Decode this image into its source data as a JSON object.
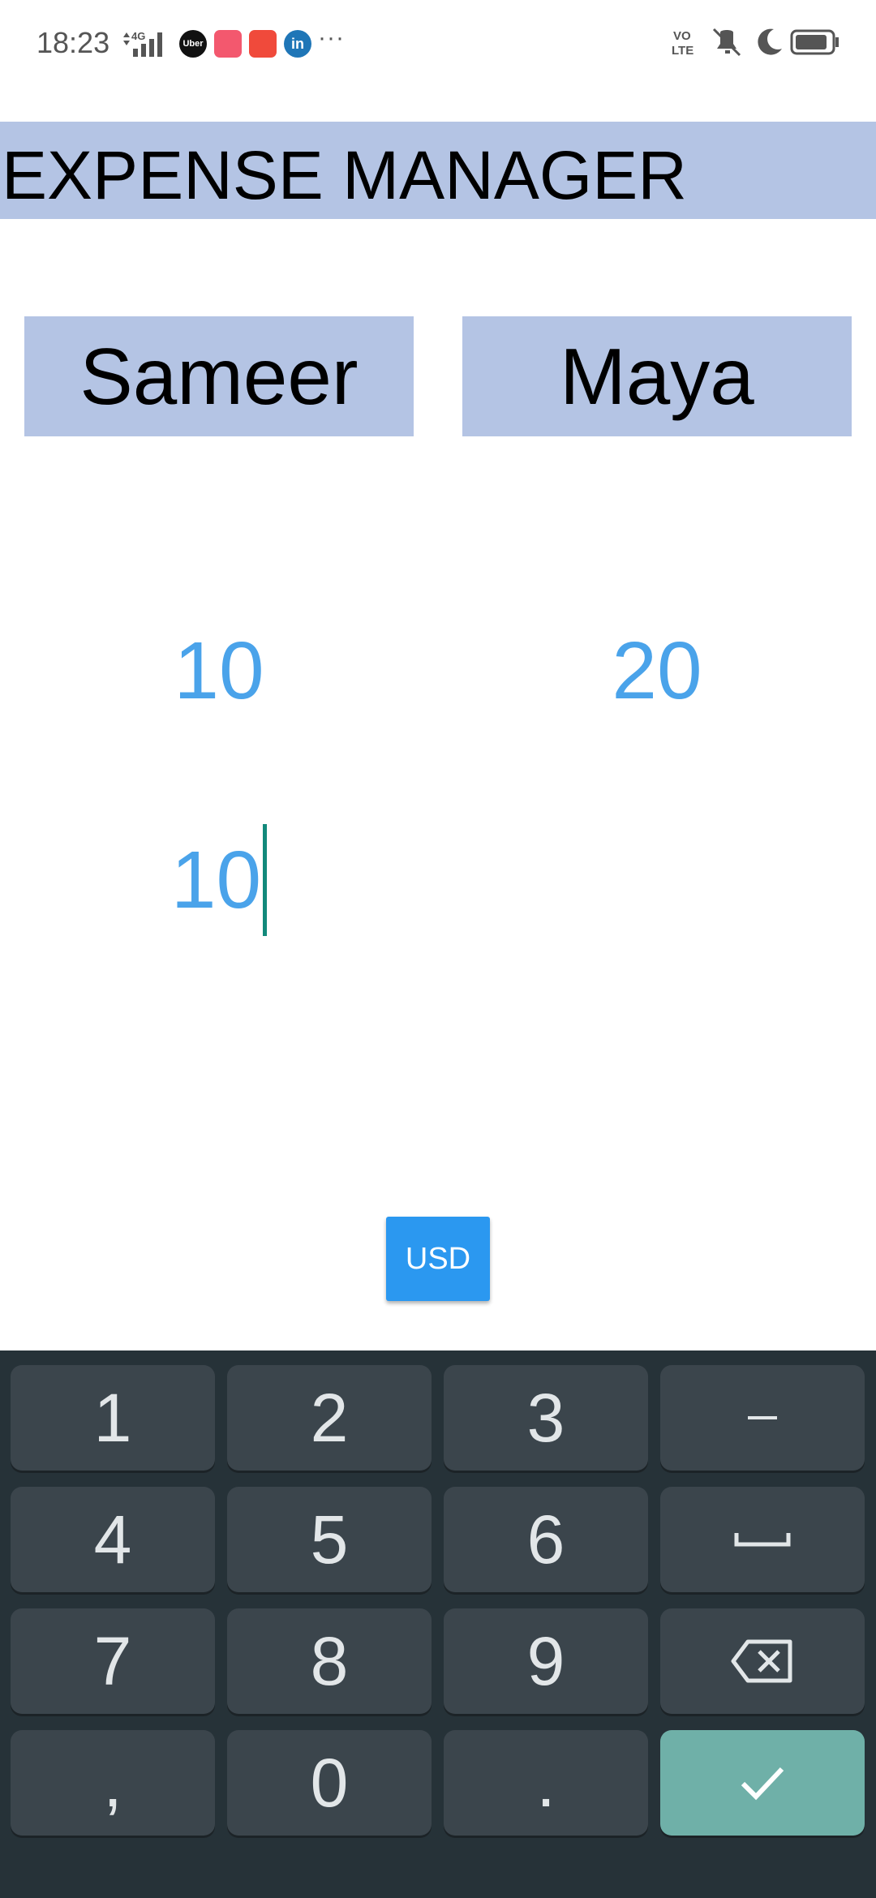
{
  "status_bar": {
    "time": "18:23",
    "network": "4G",
    "apps": [
      "uber-icon",
      "app-pink-icon",
      "app-red-icon",
      "linkedin-icon"
    ],
    "uber_label": "Uber",
    "linkedin_label": "in",
    "more": "···",
    "volte": "VO LTE"
  },
  "header": {
    "title": "EXPENSE MANAGER"
  },
  "people": {
    "left": {
      "name": "Sameer",
      "amount": "10"
    },
    "right": {
      "name": "Maya",
      "amount": "20"
    }
  },
  "input": {
    "value": "10"
  },
  "currency_button": {
    "label": "USD"
  },
  "keyboard": {
    "keys": [
      "1",
      "2",
      "3",
      "−",
      "4",
      "5",
      "6",
      "␣",
      "7",
      "8",
      "9",
      "⌫",
      ",",
      "0",
      ".",
      "✓"
    ]
  },
  "colors": {
    "accent_bg": "#b4c4e4",
    "amount_color": "#4aa3ea",
    "button_blue": "#2b98f0",
    "keyboard_bg": "#263238",
    "key_bg": "#3b454c",
    "enter_key": "#6fb0a8"
  }
}
